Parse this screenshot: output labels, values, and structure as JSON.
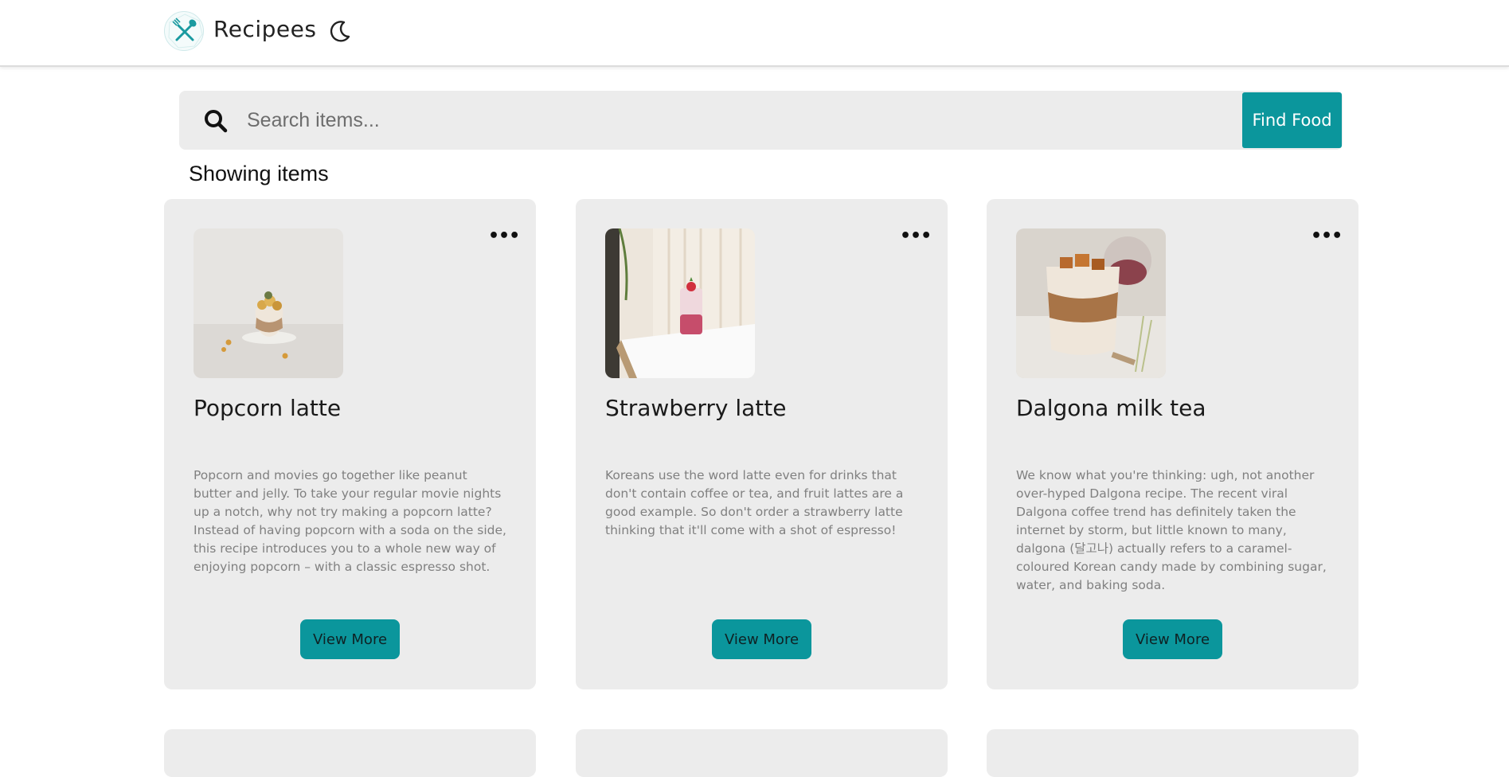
{
  "header": {
    "brand": "Recipees",
    "logo_icon": "crossed-utensils-icon",
    "theme_icon": "moon-icon"
  },
  "search": {
    "placeholder": "Search items...",
    "value": "",
    "button_label": "Find Food",
    "icon": "search-icon"
  },
  "section_title": "Showing items",
  "colors": {
    "accent": "#0b969c",
    "card_bg": "#ececec",
    "muted_text": "#808080"
  },
  "cards": [
    {
      "title": "Popcorn latte",
      "description": "Popcorn and movies go together like peanut butter and jelly. To take your regular movie nights up a notch, why not try making a popcorn latte? Instead of having popcorn with a soda on the side, this recipe introduces you to a whole new way of enjoying popcorn – with a classic espresso shot.",
      "button_label": "View More",
      "menu_icon": "more-horizontal-icon"
    },
    {
      "title": "Strawberry latte",
      "description": "Koreans use the word latte even for drinks that don't contain coffee or tea, and fruit lattes are a good example. So don't order a strawberry latte thinking that it'll come with a shot of espresso!",
      "button_label": "View More",
      "menu_icon": "more-horizontal-icon"
    },
    {
      "title": "Dalgona milk tea",
      "description": "We know what you're thinking: ugh, not another over-hyped Dalgona recipe. The recent viral Dalgona coffee trend has definitely taken the internet by storm, but little known to many, dalgona (달고나) actually refers to a caramel-coloured Korean candy made by combining sugar, water, and baking soda.",
      "button_label": "View More",
      "menu_icon": "more-horizontal-icon"
    }
  ]
}
